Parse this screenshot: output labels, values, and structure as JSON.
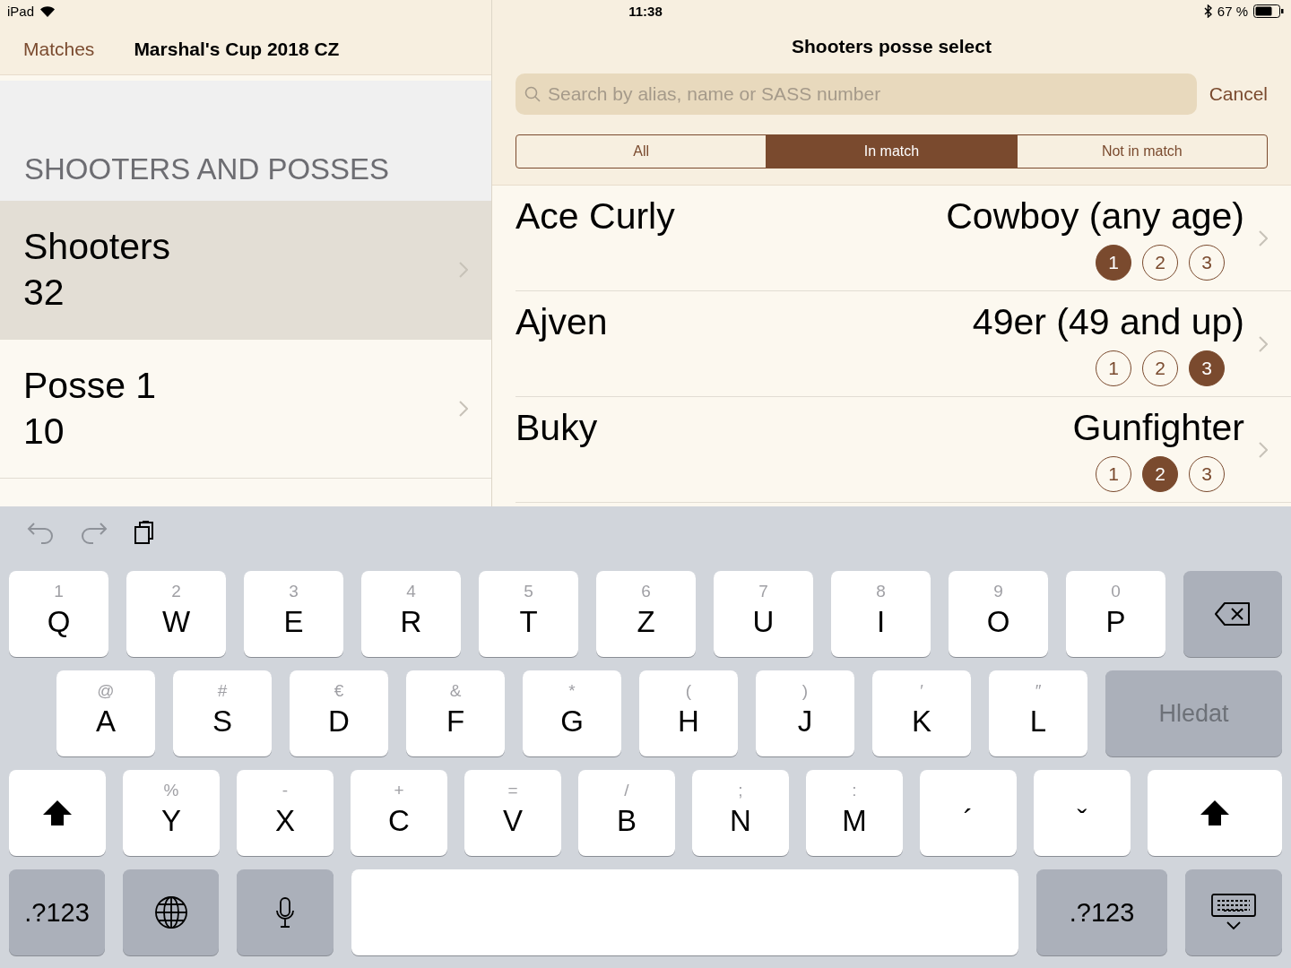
{
  "status_bar": {
    "device": "iPad",
    "time": "11:38",
    "battery": "67 %"
  },
  "master": {
    "back": "Matches",
    "title": "Marshal's Cup 2018 CZ",
    "section": "SHOOTERS AND POSSES",
    "items": [
      {
        "title": "Shooters",
        "count": "32",
        "selected": true
      },
      {
        "title": "Posse 1",
        "count": "10",
        "selected": false
      }
    ]
  },
  "detail": {
    "title": "Shooters posse select",
    "search": {
      "placeholder": "Search by alias, name or SASS number"
    },
    "cancel": "Cancel",
    "segments": [
      {
        "label": "All",
        "selected": false
      },
      {
        "label": "In match",
        "selected": true
      },
      {
        "label": "Not in match",
        "selected": false
      }
    ],
    "shooters": [
      {
        "name": "Ace Curly",
        "category": "Cowboy (any age)",
        "posses": [
          {
            "label": "1",
            "selected": true
          },
          {
            "label": "2",
            "selected": false
          },
          {
            "label": "3",
            "selected": false
          }
        ]
      },
      {
        "name": "Ajven",
        "category": "49er (49 and up)",
        "posses": [
          {
            "label": "1",
            "selected": false
          },
          {
            "label": "2",
            "selected": false
          },
          {
            "label": "3",
            "selected": true
          }
        ]
      },
      {
        "name": "Buky",
        "category": "Gunfighter",
        "posses": [
          {
            "label": "1",
            "selected": false
          },
          {
            "label": "2",
            "selected": true
          },
          {
            "label": "3",
            "selected": false
          }
        ]
      }
    ]
  },
  "keyboard": {
    "rows": [
      {
        "keys": [
          {
            "kind": "letter",
            "hint": "1",
            "label": "Q"
          },
          {
            "kind": "letter",
            "hint": "2",
            "label": "W"
          },
          {
            "kind": "letter",
            "hint": "3",
            "label": "E"
          },
          {
            "kind": "letter",
            "hint": "4",
            "label": "R"
          },
          {
            "kind": "letter",
            "hint": "5",
            "label": "T"
          },
          {
            "kind": "letter",
            "hint": "6",
            "label": "Z"
          },
          {
            "kind": "letter",
            "hint": "7",
            "label": "U"
          },
          {
            "kind": "letter",
            "hint": "8",
            "label": "I"
          },
          {
            "kind": "letter",
            "hint": "9",
            "label": "O"
          },
          {
            "kind": "letter",
            "hint": "0",
            "label": "P"
          },
          {
            "kind": "delete"
          }
        ]
      },
      {
        "keys": [
          {
            "kind": "letter",
            "hint": "@",
            "label": "A"
          },
          {
            "kind": "letter",
            "hint": "#",
            "label": "S"
          },
          {
            "kind": "letter",
            "hint": "€",
            "label": "D"
          },
          {
            "kind": "letter",
            "hint": "&",
            "label": "F"
          },
          {
            "kind": "letter",
            "hint": "*",
            "label": "G"
          },
          {
            "kind": "letter",
            "hint": "(",
            "label": "H"
          },
          {
            "kind": "letter",
            "hint": ")",
            "label": "J"
          },
          {
            "kind": "letter",
            "hint": "′",
            "label": "K"
          },
          {
            "kind": "letter",
            "hint": "″",
            "label": "L"
          },
          {
            "kind": "action",
            "label": "Hledat"
          }
        ]
      },
      {
        "keys": [
          {
            "kind": "shift"
          },
          {
            "kind": "letter",
            "hint": "%",
            "label": "Y"
          },
          {
            "kind": "letter",
            "hint": "-",
            "label": "X"
          },
          {
            "kind": "letter",
            "hint": "+",
            "label": "C"
          },
          {
            "kind": "letter",
            "hint": "=",
            "label": "V"
          },
          {
            "kind": "letter",
            "hint": "/",
            "label": "B"
          },
          {
            "kind": "letter",
            "hint": ";",
            "label": "N"
          },
          {
            "kind": "letter",
            "hint": ":",
            "label": "M"
          },
          {
            "kind": "letter",
            "label": "´"
          },
          {
            "kind": "letter",
            "label": "ˇ"
          },
          {
            "kind": "shift"
          }
        ]
      },
      {
        "keys": [
          {
            "kind": "mode",
            "label": ".?123"
          },
          {
            "kind": "globe"
          },
          {
            "kind": "mic"
          },
          {
            "kind": "space"
          },
          {
            "kind": "mode",
            "label": ".?123"
          },
          {
            "kind": "hide"
          }
        ]
      }
    ]
  }
}
